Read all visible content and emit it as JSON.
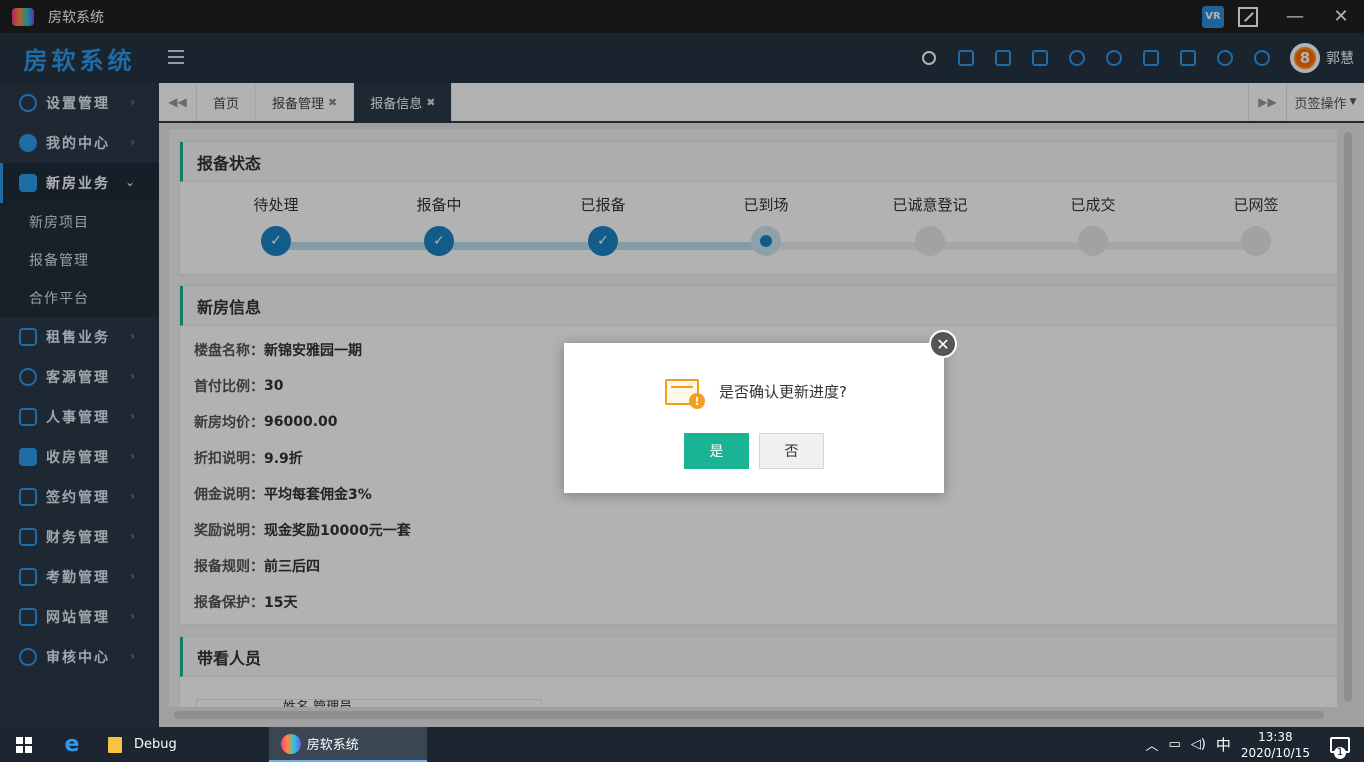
{
  "window": {
    "title": "房软系统"
  },
  "header": {
    "brand": "房软系统",
    "username": "郭慧",
    "avatar_digit": "8"
  },
  "sidebar": {
    "items": [
      {
        "label": "设置管理"
      },
      {
        "label": "我的中心"
      },
      {
        "label": "新房业务"
      },
      {
        "label": "租售业务"
      },
      {
        "label": "客源管理"
      },
      {
        "label": "人事管理"
      },
      {
        "label": "收房管理"
      },
      {
        "label": "签约管理"
      },
      {
        "label": "财务管理"
      },
      {
        "label": "考勤管理"
      },
      {
        "label": "网站管理"
      },
      {
        "label": "审核中心"
      }
    ],
    "sub_items": [
      {
        "label": "新房项目"
      },
      {
        "label": "报备管理"
      },
      {
        "label": "合作平台"
      }
    ]
  },
  "tabs": {
    "items": [
      {
        "label": "首页"
      },
      {
        "label": "报备管理"
      },
      {
        "label": "报备信息"
      }
    ],
    "page_ops": "页签操作"
  },
  "status_panel": {
    "title": "报备状态",
    "steps": [
      {
        "label": "待处理",
        "state": "done"
      },
      {
        "label": "报备中",
        "state": "done"
      },
      {
        "label": "已报备",
        "state": "done"
      },
      {
        "label": "已到场",
        "state": "current"
      },
      {
        "label": "已诚意登记",
        "state": "todo"
      },
      {
        "label": "已成交",
        "state": "todo"
      },
      {
        "label": "已网签",
        "state": "todo"
      }
    ]
  },
  "info_panel": {
    "title": "新房信息",
    "rows": [
      {
        "key": "楼盘名称：",
        "value": "新锦安雅园一期"
      },
      {
        "key": "首付比例：",
        "value": "30"
      },
      {
        "key": "新房均价：",
        "value": "96000.00"
      },
      {
        "key": "折扣说明：",
        "value": "9.9折"
      },
      {
        "key": "佣金说明：",
        "value": "平均每套佣金3%"
      },
      {
        "key": "奖励说明：",
        "value": "现金奖励10000元一套"
      },
      {
        "key": "报备规则：",
        "value": "前三后四"
      },
      {
        "key": "报备保护：",
        "value": "15天"
      }
    ]
  },
  "people_panel": {
    "title": "带看人员",
    "partial_text": "姓名  管理员"
  },
  "dialog": {
    "message": "是否确认更新进度?",
    "yes_label": "是",
    "no_label": "否"
  },
  "taskbar": {
    "items": [
      {
        "label": "Debug"
      },
      {
        "label": "房软系统"
      }
    ],
    "ime": "中",
    "time": "13:38",
    "date": "2020/10/15",
    "notif_count": "1"
  },
  "colors": {
    "brand_blue": "#2d9bf0",
    "accent_green": "#1ab394",
    "step_blue": "#1c84c6",
    "sidebar_bg": "#2b3a4a"
  }
}
